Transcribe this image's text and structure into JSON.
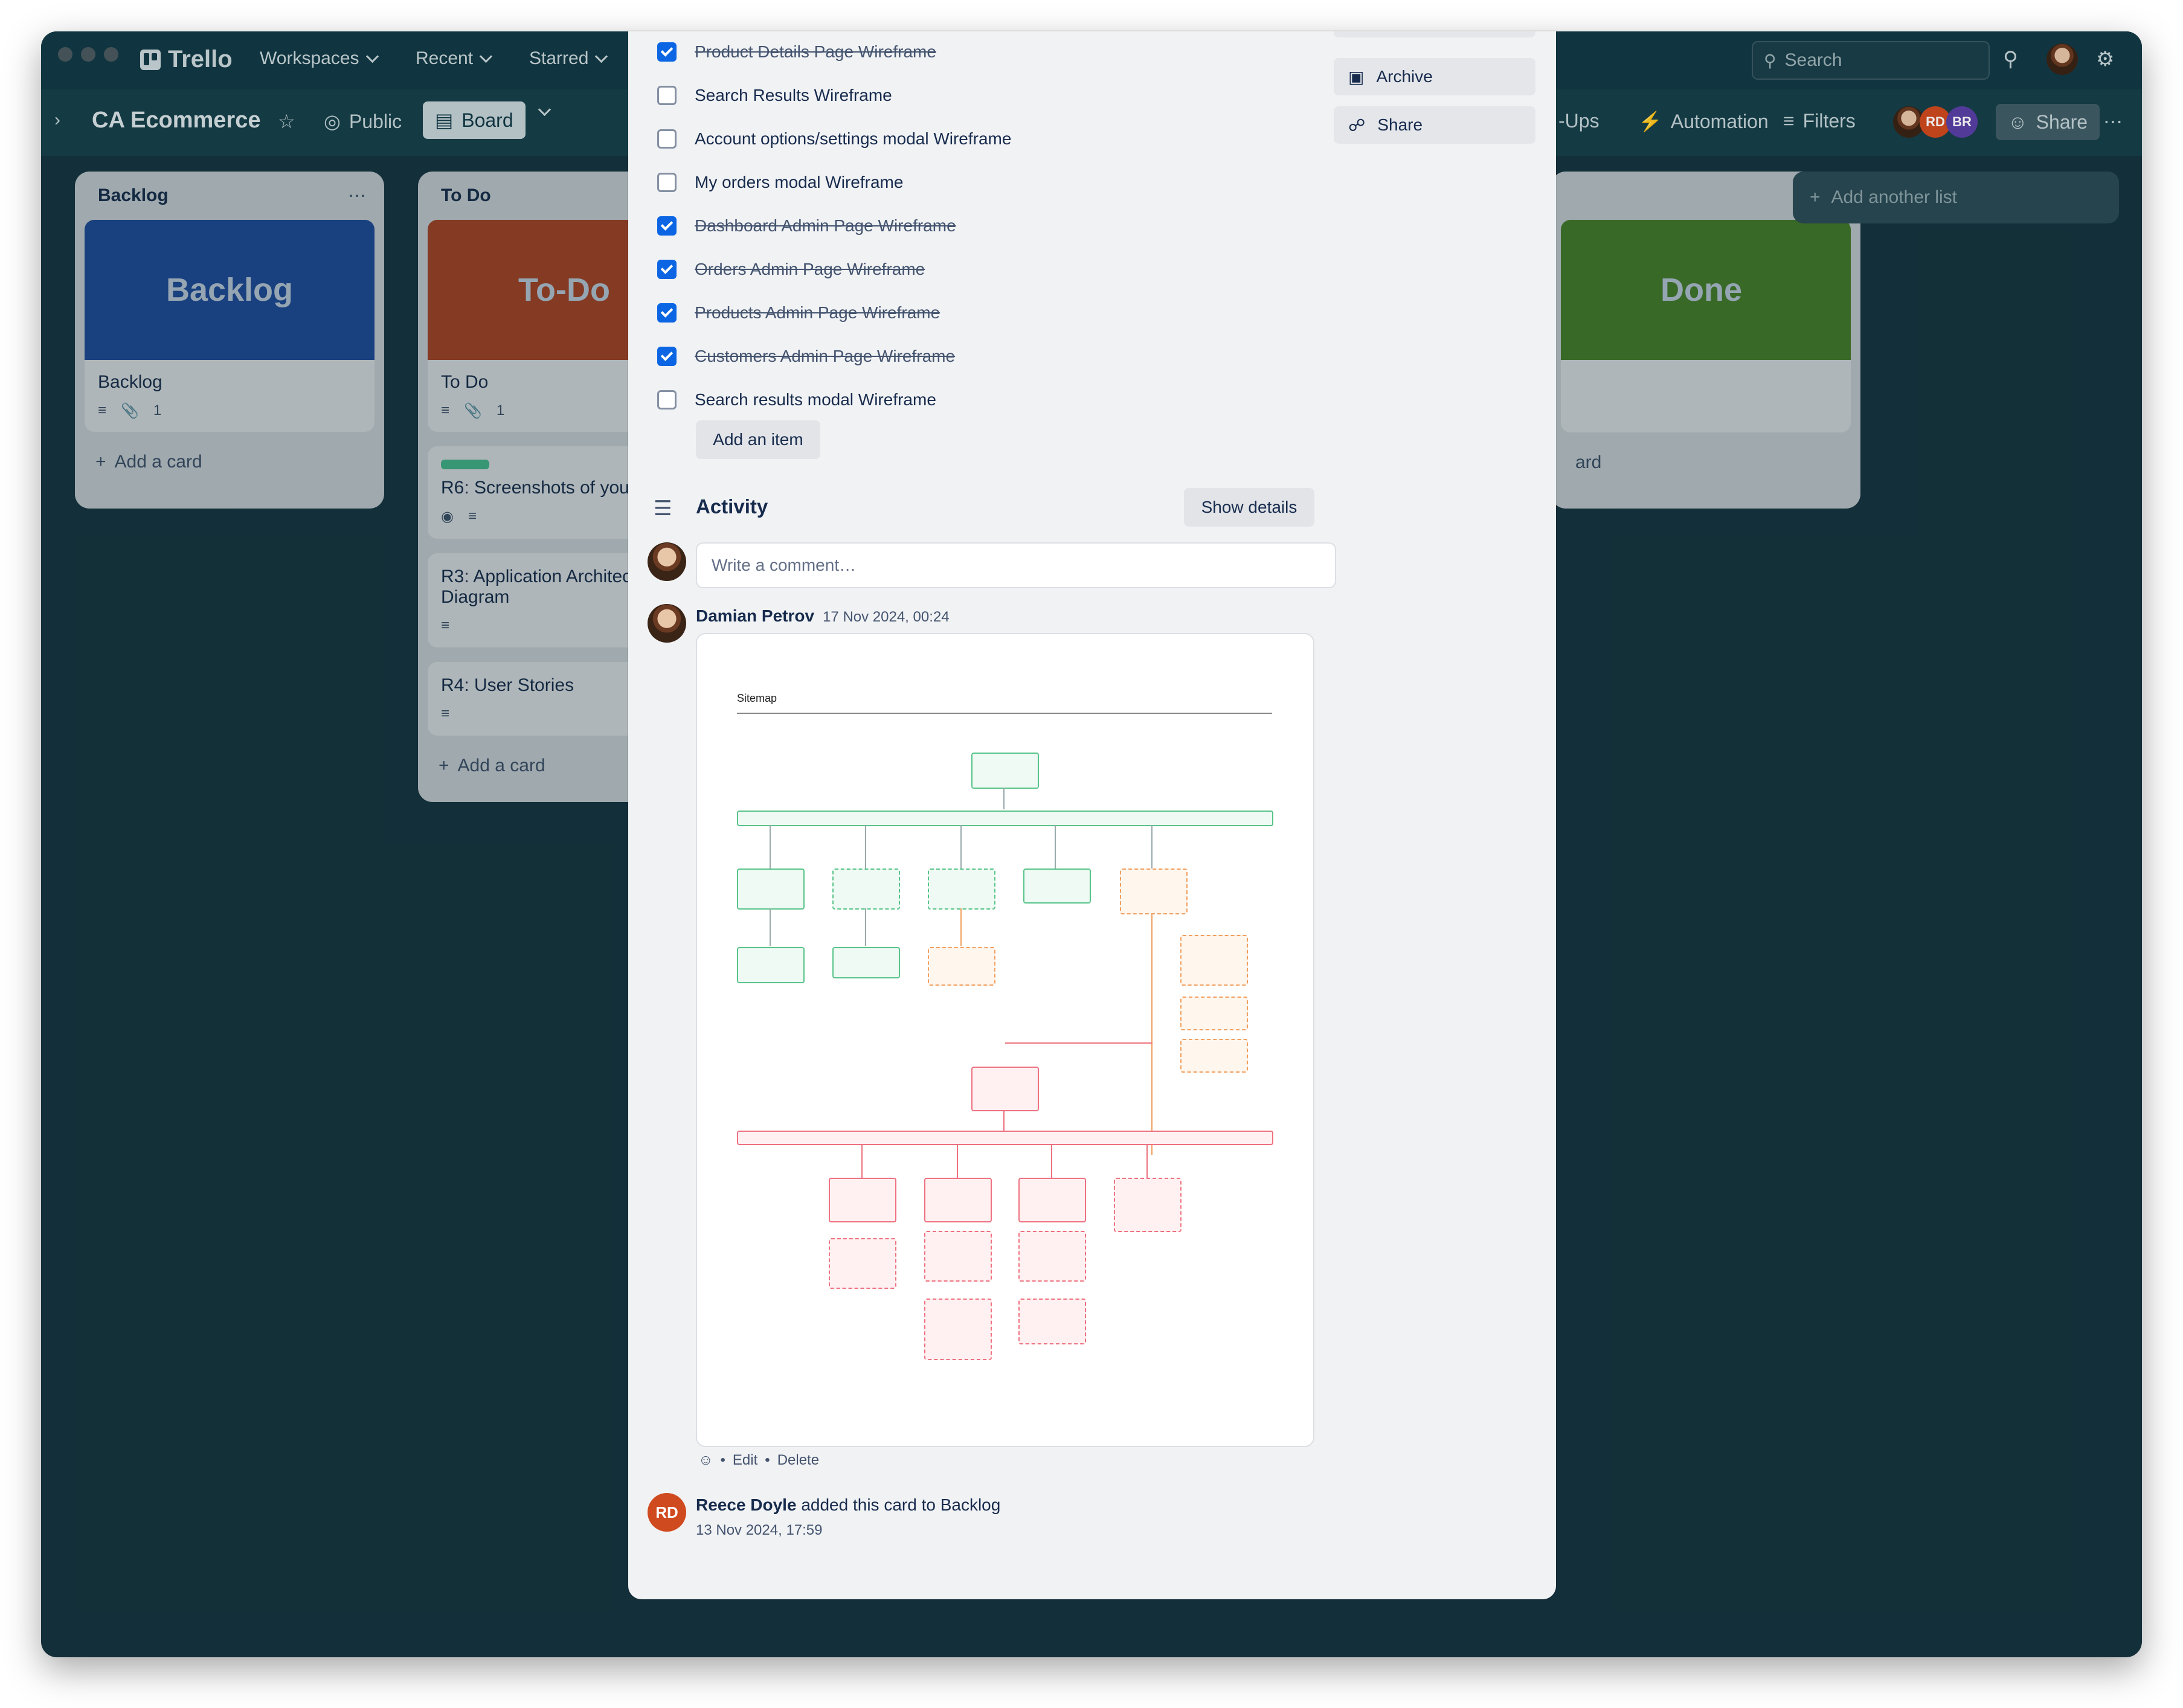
{
  "app": {
    "name": "Trello"
  },
  "topbar": {
    "workspaces": "Workspaces",
    "recent": "Recent",
    "starred": "Starred",
    "search_placeholder": "Search"
  },
  "board": {
    "title": "CA Ecommerce",
    "visibility": "Public",
    "view": "Board",
    "powerups": "-Ups",
    "automation": "Automation",
    "filters": "Filters",
    "share": "Share",
    "members": [
      "RD",
      "BR"
    ]
  },
  "lists": [
    {
      "title": "Backlog",
      "cover": "Backlog",
      "card": "Backlog",
      "attachments": "1",
      "add": "Add a card"
    },
    {
      "title": "To Do",
      "cover": "To-Do",
      "card": "To Do",
      "attachments": "1",
      "add": "Add a card",
      "cards": [
        "R6: Screenshots of your",
        "R3: Application Architec",
        "Diagram",
        "R4: User Stories"
      ]
    },
    {
      "cover": "Done",
      "add": "ard"
    }
  ],
  "add_list": "Add another list",
  "modal": {
    "checklist": [
      {
        "text": "Product Details Page Wireframe",
        "done": true
      },
      {
        "text": "Search Results Wireframe",
        "done": false
      },
      {
        "text": "Account options/settings modal Wireframe",
        "done": false
      },
      {
        "text": "My orders modal Wireframe",
        "done": false
      },
      {
        "text": "Dashboard Admin Page Wireframe",
        "done": true
      },
      {
        "text": "Orders Admin Page Wireframe",
        "done": true
      },
      {
        "text": "Products Admin Page Wireframe",
        "done": true
      },
      {
        "text": "Customers Admin Page Wireframe",
        "done": true
      },
      {
        "text": "Search results modal Wireframe",
        "done": false
      }
    ],
    "add_item": "Add an item",
    "sidebar": {
      "archive": "Archive",
      "share": "Share"
    },
    "activity": {
      "title": "Activity",
      "show_details": "Show details",
      "comment_placeholder": "Write a comment…",
      "comment": {
        "author": "Damian Petrov",
        "time": "17 Nov 2024, 00:24",
        "attachment_title": "Sitemap",
        "actions": {
          "sep": "•",
          "edit": "Edit",
          "delete": "Delete"
        }
      },
      "event": {
        "initials": "RD",
        "author": "Reece Doyle",
        "text": "added this card to Backlog",
        "time": "13 Nov 2024, 17:59"
      }
    }
  },
  "colors": {
    "backlog_cover": "#1f4ea8",
    "todo_cover": "#c0441d",
    "done_cover": "#4f8a24",
    "check_blue": "#0c66e4",
    "rd_avatar": "#d04a1f",
    "br_avatar": "#5a3fa6"
  }
}
